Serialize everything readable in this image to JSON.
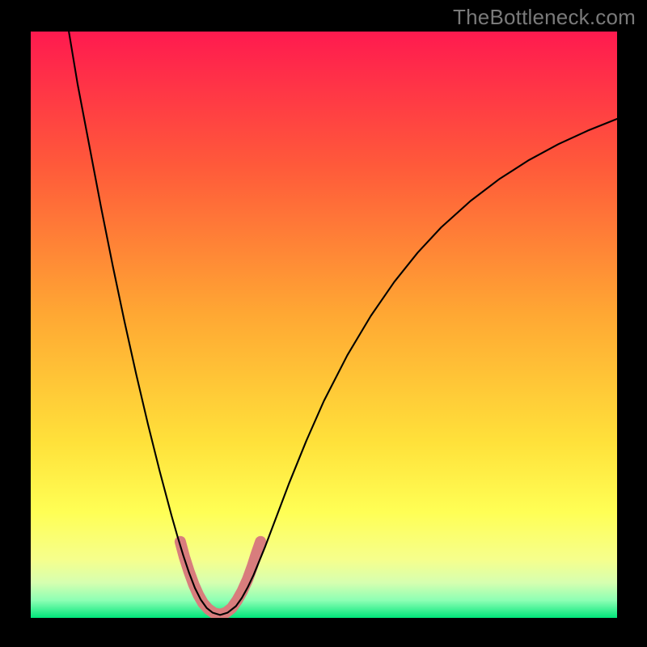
{
  "watermark": "TheBottleneck.com",
  "chart_data": {
    "type": "line",
    "title": "",
    "xlabel": "",
    "ylabel": "",
    "xlim": [
      0,
      100
    ],
    "ylim": [
      0,
      100
    ],
    "grid": false,
    "legend": false,
    "background_gradient_stops": [
      {
        "offset": 0.0,
        "color": "#ff1a4f"
      },
      {
        "offset": 0.23,
        "color": "#ff5a3a"
      },
      {
        "offset": 0.48,
        "color": "#ffa733"
      },
      {
        "offset": 0.7,
        "color": "#ffe13a"
      },
      {
        "offset": 0.82,
        "color": "#ffff55"
      },
      {
        "offset": 0.9,
        "color": "#f6ff8c"
      },
      {
        "offset": 0.94,
        "color": "#d6ffb0"
      },
      {
        "offset": 0.97,
        "color": "#8dffb4"
      },
      {
        "offset": 1.0,
        "color": "#00e67a"
      }
    ],
    "series": [
      {
        "name": "curve",
        "color": "#000000",
        "stroke_width": 2.1,
        "points": [
          {
            "x": 6.5,
            "y": 100.0
          },
          {
            "x": 8.0,
            "y": 91.0
          },
          {
            "x": 10.0,
            "y": 80.5
          },
          {
            "x": 12.0,
            "y": 70.0
          },
          {
            "x": 14.0,
            "y": 60.0
          },
          {
            "x": 16.0,
            "y": 50.5
          },
          {
            "x": 18.0,
            "y": 41.5
          },
          {
            "x": 20.0,
            "y": 33.0
          },
          {
            "x": 22.0,
            "y": 25.0
          },
          {
            "x": 24.0,
            "y": 17.5
          },
          {
            "x": 25.0,
            "y": 14.0
          },
          {
            "x": 26.0,
            "y": 10.7
          },
          {
            "x": 27.0,
            "y": 7.7
          },
          {
            "x": 28.0,
            "y": 5.1
          },
          {
            "x": 29.0,
            "y": 3.1
          },
          {
            "x": 30.0,
            "y": 1.7
          },
          {
            "x": 31.0,
            "y": 0.9
          },
          {
            "x": 32.3,
            "y": 0.5
          },
          {
            "x": 33.6,
            "y": 0.9
          },
          {
            "x": 35.0,
            "y": 2.0
          },
          {
            "x": 36.0,
            "y": 3.4
          },
          {
            "x": 37.0,
            "y": 5.2
          },
          {
            "x": 38.0,
            "y": 7.3
          },
          {
            "x": 40.0,
            "y": 12.2
          },
          {
            "x": 42.0,
            "y": 17.5
          },
          {
            "x": 44.0,
            "y": 22.8
          },
          {
            "x": 47.0,
            "y": 30.2
          },
          {
            "x": 50.0,
            "y": 37.0
          },
          {
            "x": 54.0,
            "y": 44.8
          },
          {
            "x": 58.0,
            "y": 51.5
          },
          {
            "x": 62.0,
            "y": 57.3
          },
          {
            "x": 66.0,
            "y": 62.3
          },
          {
            "x": 70.0,
            "y": 66.6
          },
          {
            "x": 75.0,
            "y": 71.1
          },
          {
            "x": 80.0,
            "y": 74.9
          },
          {
            "x": 85.0,
            "y": 78.1
          },
          {
            "x": 90.0,
            "y": 80.8
          },
          {
            "x": 95.0,
            "y": 83.1
          },
          {
            "x": 100.0,
            "y": 85.1
          }
        ]
      },
      {
        "name": "highlight-segment",
        "color": "#d87d7d",
        "stroke_width": 14,
        "linecap": "round",
        "points": [
          {
            "x": 25.5,
            "y": 13.0
          },
          {
            "x": 26.2,
            "y": 10.4
          },
          {
            "x": 27.0,
            "y": 7.9
          },
          {
            "x": 27.8,
            "y": 5.7
          },
          {
            "x": 28.6,
            "y": 3.9
          },
          {
            "x": 29.4,
            "y": 2.5
          },
          {
            "x": 30.3,
            "y": 1.5
          },
          {
            "x": 31.3,
            "y": 0.8
          },
          {
            "x": 32.3,
            "y": 0.6
          },
          {
            "x": 33.3,
            "y": 0.9
          },
          {
            "x": 34.3,
            "y": 1.7
          },
          {
            "x": 35.2,
            "y": 3.0
          },
          {
            "x": 36.1,
            "y": 4.6
          },
          {
            "x": 37.0,
            "y": 6.6
          },
          {
            "x": 37.8,
            "y": 8.8
          },
          {
            "x": 38.5,
            "y": 11.0
          },
          {
            "x": 39.2,
            "y": 13.0
          }
        ]
      }
    ]
  }
}
